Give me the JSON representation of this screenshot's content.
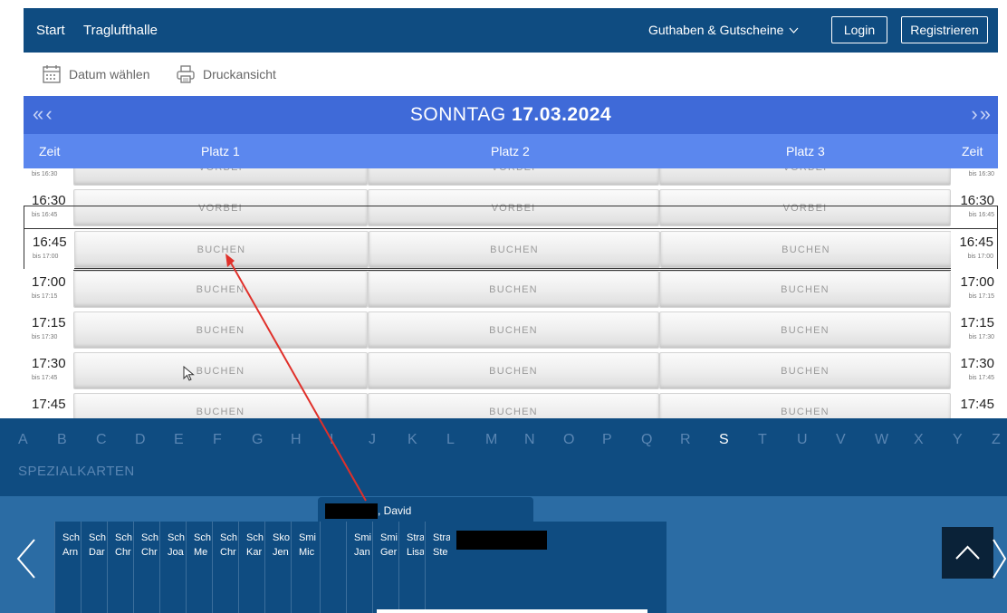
{
  "topnav": {
    "start": "Start",
    "venue": "Traglufthalle",
    "credits": "Guthaben & Gutscheine",
    "login": "Login",
    "register": "Registrieren"
  },
  "toolbar": {
    "date_pick": "Datum wählen",
    "print_view": "Druckansicht"
  },
  "date_header": {
    "weekday": "SONNTAG",
    "date": "17.03.2024",
    "prev_icons": "« ‹",
    "next_icons": "› »"
  },
  "columns": {
    "time_left": "Zeit",
    "court1": "Platz 1",
    "court2": "Platz 2",
    "court3": "Platz 3",
    "time_right": "Zeit"
  },
  "rows": [
    {
      "time": "",
      "until": "bis 16:30",
      "s1": "VORBEI",
      "s2": "VORBEI",
      "s3": "VORBEI"
    },
    {
      "time": "16:30",
      "until": "bis 16:45",
      "s1": "VORBEI",
      "s2": "VORBEI",
      "s3": "VORBEI"
    },
    {
      "time": "16:45",
      "until": "bis 17:00",
      "s1": "BUCHEN",
      "s2": "BUCHEN",
      "s3": "BUCHEN"
    },
    {
      "time": "17:00",
      "until": "bis 17:15",
      "s1": "BUCHEN",
      "s2": "BUCHEN",
      "s3": "BUCHEN"
    },
    {
      "time": "17:15",
      "until": "bis 17:30",
      "s1": "BUCHEN",
      "s2": "BUCHEN",
      "s3": "BUCHEN"
    },
    {
      "time": "17:30",
      "until": "bis 17:45",
      "s1": "BUCHEN",
      "s2": "BUCHEN",
      "s3": "BUCHEN"
    },
    {
      "time": "17:45",
      "until": "",
      "s1": "BUCHEN",
      "s2": "BUCHEN",
      "s3": "BUCHEN"
    }
  ],
  "letters": [
    "A",
    "B",
    "C",
    "D",
    "E",
    "F",
    "G",
    "H",
    "I",
    "J",
    "K",
    "L",
    "M",
    "N",
    "O",
    "P",
    "Q",
    "R",
    "S",
    "T",
    "U",
    "V",
    "W",
    "X",
    "Y",
    "Z"
  ],
  "active_letter": "S",
  "special_cards": "SPEZIALKARTEN",
  "popup_name": ", David",
  "cards": [
    {
      "l1": "Sch",
      "l2": "Arn"
    },
    {
      "l1": "Sch",
      "l2": "Dar"
    },
    {
      "l1": "Sch",
      "l2": "Chr"
    },
    {
      "l1": "Sch",
      "l2": "Chr"
    },
    {
      "l1": "Sch",
      "l2": "Joa"
    },
    {
      "l1": "Sch",
      "l2": "Me"
    },
    {
      "l1": "Sch",
      "l2": "Chr"
    },
    {
      "l1": "Sch",
      "l2": "Kar"
    },
    {
      "l1": "Sko",
      "l2": "Jen"
    },
    {
      "l1": "Smi",
      "l2": "Mic"
    },
    {
      "l1": "",
      "l2": ""
    },
    {
      "l1": "Smi",
      "l2": "Jan"
    },
    {
      "l1": "Smi",
      "l2": "Ger"
    },
    {
      "l1": "Stra",
      "l2": "Lisa"
    },
    {
      "l1": "Stra",
      "l2": "Ste"
    }
  ],
  "colors": {
    "navy": "#0f4c81",
    "date_blue": "#3f6ad8",
    "header_blue": "#5b87ee",
    "panel_blue": "#2b6ca4",
    "annotation_red": "#e0302a"
  },
  "icons": [
    "calendar-icon",
    "printer-icon",
    "chevron-down-icon",
    "double-chevron-left-icon",
    "double-chevron-right-icon",
    "chevron-left-icon",
    "chevron-right-icon",
    "chevron-up-icon",
    "cursor-icon"
  ]
}
